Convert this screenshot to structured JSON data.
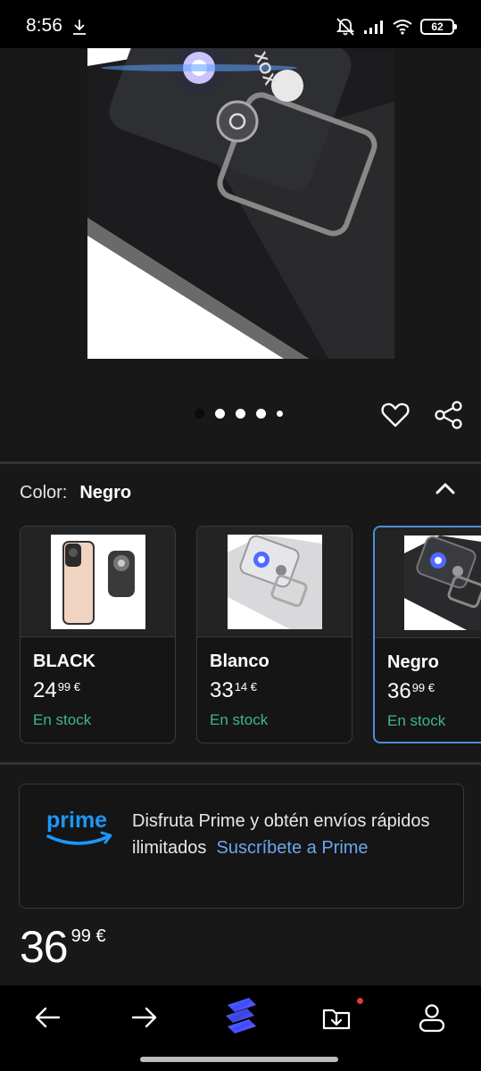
{
  "status_bar": {
    "time": "8:56",
    "battery": "62",
    "icons": [
      "download-icon",
      "dnd-muted-icon",
      "signal-icon",
      "wifi-icon",
      "battery-icon"
    ]
  },
  "gallery": {
    "total_images": 5,
    "active_index": 0,
    "icons": [
      "heart-icon",
      "share-icon"
    ]
  },
  "color_selector": {
    "label": "Color:",
    "selected": "Negro",
    "variants": [
      {
        "name": "BLACK",
        "price_int": "24",
        "price_dec": "99",
        "currency": "€",
        "stock": "En stock",
        "selected": false
      },
      {
        "name": "Blanco",
        "price_int": "33",
        "price_dec": "14",
        "currency": "€",
        "stock": "En stock",
        "selected": false
      },
      {
        "name": "Negro",
        "price_int": "36",
        "price_dec": "99",
        "currency": "€",
        "stock": "En stock",
        "selected": true
      }
    ]
  },
  "prime": {
    "logo": "prime",
    "text": "Disfruta Prime y obtén envíos rápidos ilimitados",
    "link": "Suscríbete a Prime"
  },
  "price": {
    "int": "36",
    "dec": "99",
    "currency": "€"
  },
  "colors": {
    "background": "#181818",
    "accent_blue": "#4a8fd8",
    "stock_green": "#3fb68b",
    "prime_blue": "#1a98ff",
    "link_blue": "#6ba6ef"
  },
  "bottom_nav": {
    "items": [
      "back-icon",
      "forward-icon",
      "app-home-icon",
      "downloads-icon",
      "profile-icon"
    ]
  }
}
